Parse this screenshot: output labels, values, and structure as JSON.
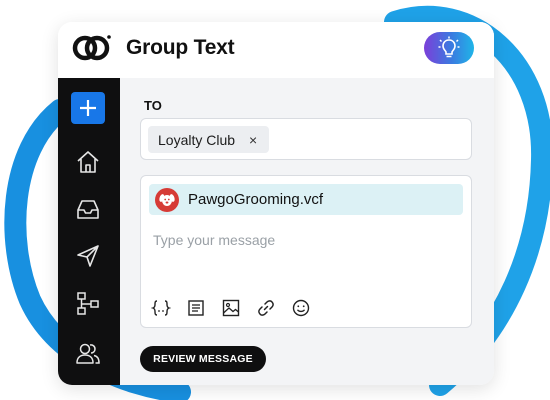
{
  "app": {
    "title": "Group Text",
    "accent": "#1877e8"
  },
  "header": {
    "logo_icon": "logo-icon",
    "idea_icon": "lightbulb-icon"
  },
  "sidebar": {
    "items": [
      {
        "icon": "plus-icon"
      },
      {
        "icon": "home-icon"
      },
      {
        "icon": "inbox-icon"
      },
      {
        "icon": "send-icon"
      },
      {
        "icon": "workflow-icon"
      },
      {
        "icon": "contacts-icon"
      }
    ]
  },
  "compose": {
    "to_label": "TO",
    "recipients": [
      {
        "label": "Loyalty Club",
        "remove": "×"
      }
    ],
    "attachment": {
      "name": "PawgoGrooming.vcf",
      "icon": "dog-avatar-icon"
    },
    "message_placeholder": "Type your message",
    "toolbar_icons": [
      "variables-icon",
      "template-icon",
      "image-icon",
      "link-icon",
      "emoji-icon"
    ],
    "review_label": "REVIEW MESSAGE"
  }
}
